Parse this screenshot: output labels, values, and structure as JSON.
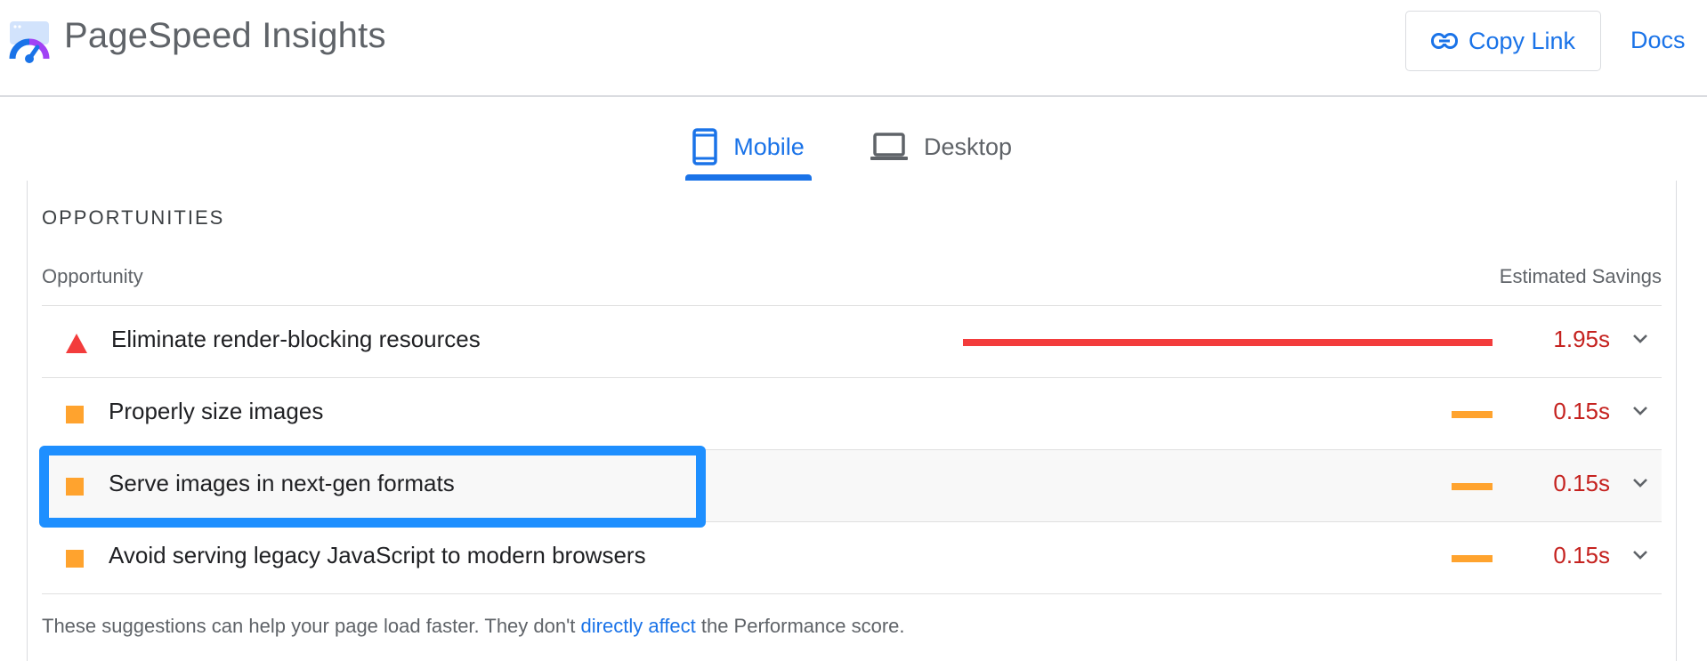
{
  "header": {
    "app_title": "PageSpeed Insights",
    "copy_link_label": "Copy Link",
    "docs_label": "Docs"
  },
  "tabs": [
    {
      "label": "Mobile",
      "icon": "smartphone-icon",
      "selected": true
    },
    {
      "label": "Desktop",
      "icon": "laptop-icon",
      "selected": false
    }
  ],
  "opportunities": {
    "section_title": "OPPORTUNITIES",
    "column_left": "Opportunity",
    "column_right": "Estimated Savings",
    "rows": [
      {
        "title": "Eliminate render-blocking resources",
        "savings": "1.95s",
        "savings_seconds": 1.95,
        "severity": "fail",
        "marker_icon": "red-triangle-icon",
        "highlighted": false
      },
      {
        "title": "Properly size images",
        "savings": "0.15s",
        "savings_seconds": 0.15,
        "severity": "average",
        "marker_icon": "orange-square-icon",
        "highlighted": false
      },
      {
        "title": "Serve images in next-gen formats",
        "savings": "0.15s",
        "savings_seconds": 0.15,
        "severity": "average",
        "marker_icon": "orange-square-icon",
        "highlighted": true
      },
      {
        "title": "Avoid serving legacy JavaScript to modern browsers",
        "savings": "0.15s",
        "savings_seconds": 0.15,
        "severity": "average",
        "marker_icon": "orange-square-icon",
        "highlighted": false
      }
    ],
    "footer_text_before": "These suggestions can help your page load faster. They don't ",
    "footer_link": "directly affect",
    "footer_text_after": " the Performance score."
  },
  "colors": {
    "brand_blue": "#1a73e8",
    "fail_red": "#f33c3c",
    "average_orange": "#ffa32e",
    "savings_text": "#c5221f",
    "annotation_box": "#1e8fff"
  }
}
